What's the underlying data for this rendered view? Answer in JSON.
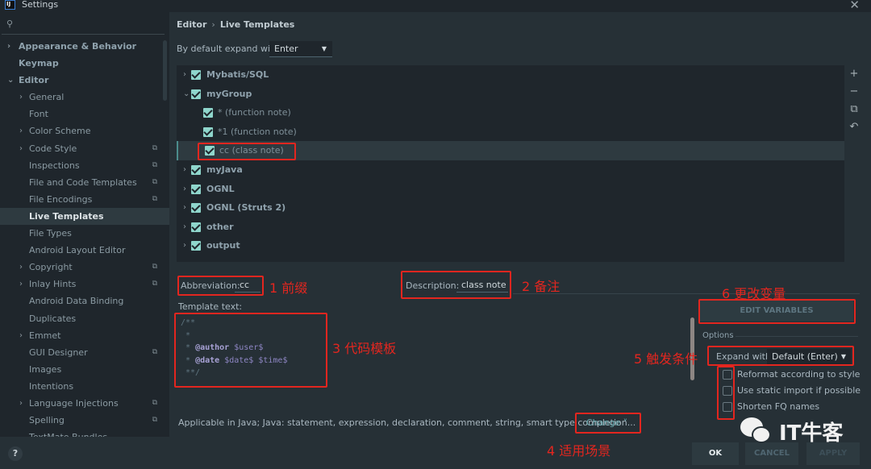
{
  "window": {
    "title": "Settings",
    "app_icon_text": "IJ"
  },
  "sidebar": {
    "items": [
      {
        "label": "Appearance & Behavior",
        "level": 0,
        "arrow": "›"
      },
      {
        "label": "Keymap",
        "level": 0,
        "arrow": ""
      },
      {
        "label": "Editor",
        "level": 0,
        "arrow": "⌄"
      },
      {
        "label": "General",
        "level": 1,
        "arrow": "›"
      },
      {
        "label": "Font",
        "level": 1,
        "arrow": ""
      },
      {
        "label": "Color Scheme",
        "level": 1,
        "arrow": "›"
      },
      {
        "label": "Code Style",
        "level": 1,
        "arrow": "›",
        "copy": true
      },
      {
        "label": "Inspections",
        "level": 1,
        "arrow": "",
        "copy": true
      },
      {
        "label": "File and Code Templates",
        "level": 1,
        "arrow": "",
        "copy": true
      },
      {
        "label": "File Encodings",
        "level": 1,
        "arrow": "",
        "copy": true
      },
      {
        "label": "Live Templates",
        "level": 1,
        "arrow": "",
        "selected": true
      },
      {
        "label": "File Types",
        "level": 1,
        "arrow": ""
      },
      {
        "label": "Android Layout Editor",
        "level": 1,
        "arrow": ""
      },
      {
        "label": "Copyright",
        "level": 1,
        "arrow": "›",
        "copy": true
      },
      {
        "label": "Inlay Hints",
        "level": 1,
        "arrow": "›",
        "copy": true
      },
      {
        "label": "Android Data Binding",
        "level": 1,
        "arrow": ""
      },
      {
        "label": "Duplicates",
        "level": 1,
        "arrow": ""
      },
      {
        "label": "Emmet",
        "level": 1,
        "arrow": "›"
      },
      {
        "label": "GUI Designer",
        "level": 1,
        "arrow": "",
        "copy": true
      },
      {
        "label": "Images",
        "level": 1,
        "arrow": ""
      },
      {
        "label": "Intentions",
        "level": 1,
        "arrow": ""
      },
      {
        "label": "Language Injections",
        "level": 1,
        "arrow": "›",
        "copy": true
      },
      {
        "label": "Spelling",
        "level": 1,
        "arrow": "",
        "copy": true
      },
      {
        "label": "TextMate Bundles",
        "level": 1,
        "arrow": ""
      }
    ]
  },
  "header": {
    "breadcrumb": [
      "Editor",
      "Live Templates"
    ],
    "breadcrumb_sep": "›",
    "expand_label": "By default expand with",
    "expand_value": "Enter"
  },
  "templates": {
    "rows": [
      {
        "label": "Mybatis/SQL",
        "type": "group",
        "arrow": "›",
        "checked": true
      },
      {
        "label": "myGroup",
        "type": "group",
        "arrow": "⌄",
        "checked": true
      },
      {
        "label": "* (function note)",
        "type": "child",
        "checked": true
      },
      {
        "label": "*1 (function note)",
        "type": "child",
        "checked": true
      },
      {
        "label": "cc (class note)",
        "type": "child",
        "checked": true,
        "selected": true
      },
      {
        "label": "myJava",
        "type": "group",
        "arrow": "›",
        "checked": true
      },
      {
        "label": "OGNL",
        "type": "group",
        "arrow": "›",
        "checked": true
      },
      {
        "label": "OGNL (Struts 2)",
        "type": "group",
        "arrow": "›",
        "checked": true
      },
      {
        "label": "other",
        "type": "group",
        "arrow": "›",
        "checked": true
      },
      {
        "label": "output",
        "type": "group",
        "arrow": "›",
        "checked": true
      }
    ],
    "tools": {
      "add": "+",
      "remove": "−",
      "copy": "⧉",
      "revert": "↶"
    }
  },
  "editor": {
    "abbreviation_label": "Abbreviation:",
    "abbreviation_value": "cc",
    "description_label": "Description:",
    "description_value": "class note",
    "template_text_label": "Template text:",
    "template_lines": [
      {
        "prefix": "/**",
        "kw": "",
        "vars": ""
      },
      {
        "prefix": " *",
        "kw": "",
        "vars": ""
      },
      {
        "prefix": " * ",
        "kw": "@author",
        "vars": " $user$"
      },
      {
        "prefix": " * ",
        "kw": "@date",
        "vars": " $date$ $time$"
      },
      {
        "prefix": " **/",
        "kw": "",
        "vars": ""
      }
    ],
    "applicable_text": "Applicable in Java; Java: statement, expression, declaration, comment, string, smart type completion...",
    "change_label": "Change ˅"
  },
  "options": {
    "edit_variables_label": "EDIT VARIABLES",
    "options_label": "Options",
    "expand_with_label": "Expand with",
    "expand_with_value": "Default (Enter)",
    "checkboxes": [
      {
        "label": "Reformat according to style",
        "checked": false
      },
      {
        "label": "Use static import if possible",
        "checked": false
      },
      {
        "label": "Shorten FQ names",
        "checked": false
      }
    ]
  },
  "annotations": {
    "a1": "1 前缀",
    "a2": "2 备注",
    "a3": "3 代码模板",
    "a4": "4 适用场景",
    "a5": "5 触发条件",
    "a6": "6 更改变量",
    "annotation_color": "#e3261f"
  },
  "footer": {
    "help_label": "?",
    "ok_label": "OK",
    "cancel_label": "CANCEL",
    "apply_label": "APPLY"
  },
  "watermark": {
    "text": "IT牛客"
  },
  "colors": {
    "background": "#1f262c",
    "panel": "#263036",
    "checkbox_accent": "#8fd6cc",
    "link": "#6fb1b5"
  }
}
